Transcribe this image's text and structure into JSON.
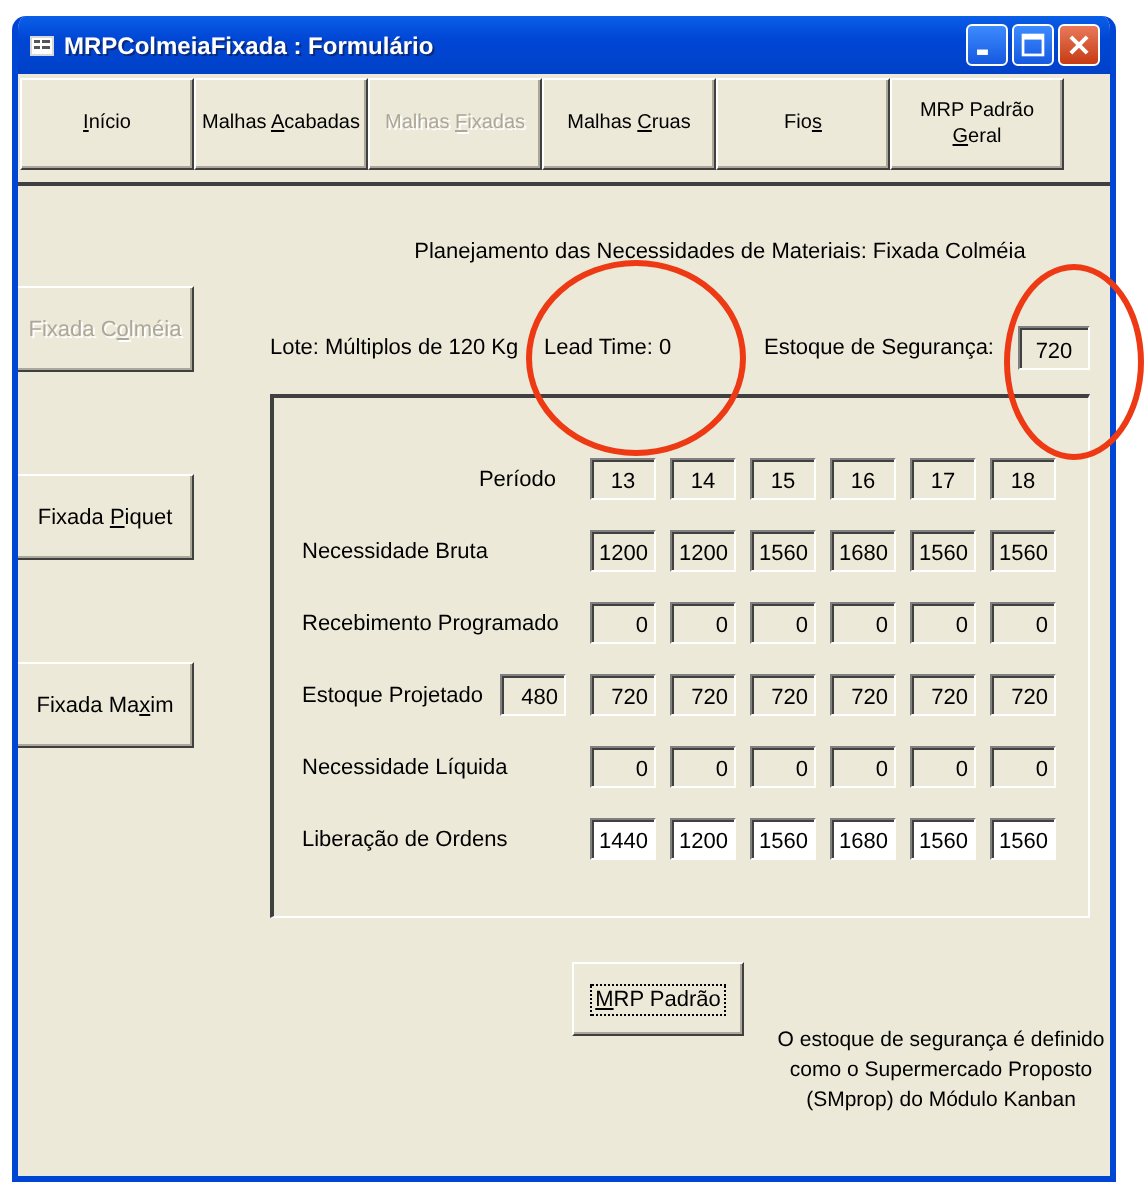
{
  "window": {
    "title": "MRPColmeiaFixada : Formulário"
  },
  "nav_tabs": [
    {
      "parts": {
        "key": "I",
        "post": "nício"
      },
      "disabled": false
    },
    {
      "parts": {
        "pre": "Malhas ",
        "key": "A",
        "post": "cabadas"
      },
      "disabled": false
    },
    {
      "parts": {
        "pre": "Malhas ",
        "key": "F",
        "post": "ixadas"
      },
      "disabled": true
    },
    {
      "parts": {
        "pre": "Malhas ",
        "key": "C",
        "post": "ruas"
      },
      "disabled": false
    },
    {
      "parts": {
        "pre": "Fio",
        "key": "s"
      },
      "disabled": false
    },
    {
      "parts": {
        "pre": "MRP Padrão ",
        "key": "G",
        "post": "eral"
      },
      "disabled": false
    }
  ],
  "side_buttons": [
    {
      "parts": {
        "pre": "Fixada C",
        "key": "o",
        "post": "lméia"
      },
      "disabled": true
    },
    {
      "parts": {
        "pre": "Fixada ",
        "key": "P",
        "post": "iquet"
      },
      "disabled": false
    },
    {
      "parts": {
        "pre": "Fixada Ma",
        "key": "x",
        "post": "im"
      },
      "disabled": false
    }
  ],
  "heading": "Planejamento das Necessidades de Materiais: Fixada Colméia",
  "lot": "Lote: Múltiplos de 120 Kg",
  "lead_time": "Lead Time: 0",
  "safety_stock": {
    "label": "Estoque de Segurança:",
    "value": "720"
  },
  "grid": {
    "period_label": "Período",
    "periods": [
      "13",
      "14",
      "15",
      "16",
      "17",
      "18"
    ],
    "rows": [
      {
        "label": "Necessidade Bruta",
        "editable": false,
        "values": [
          "1200",
          "1200",
          "1560",
          "1680",
          "1560",
          "1560"
        ]
      },
      {
        "label": "Recebimento Programado",
        "editable": false,
        "values": [
          "0",
          "0",
          "0",
          "0",
          "0",
          "0"
        ]
      },
      {
        "label": "Estoque Projetado",
        "initial": "480",
        "editable": false,
        "values": [
          "720",
          "720",
          "720",
          "720",
          "720",
          "720"
        ]
      },
      {
        "label": "Necessidade Líquida",
        "editable": false,
        "values": [
          "0",
          "0",
          "0",
          "0",
          "0",
          "0"
        ]
      },
      {
        "label": "Liberação de Ordens",
        "editable": true,
        "values": [
          "1440",
          "1200",
          "1560",
          "1680",
          "1560",
          "1560"
        ]
      }
    ]
  },
  "mrp_button": {
    "parts": {
      "key": "M",
      "post": "RP Padrão"
    },
    "focused": true
  },
  "note": "O estoque de segurança é definido como o Supermercado Proposto (SMprop) do Módulo Kanban",
  "annotations": [
    {
      "kind": "ellipse"
    },
    {
      "kind": "ellipse"
    }
  ]
}
